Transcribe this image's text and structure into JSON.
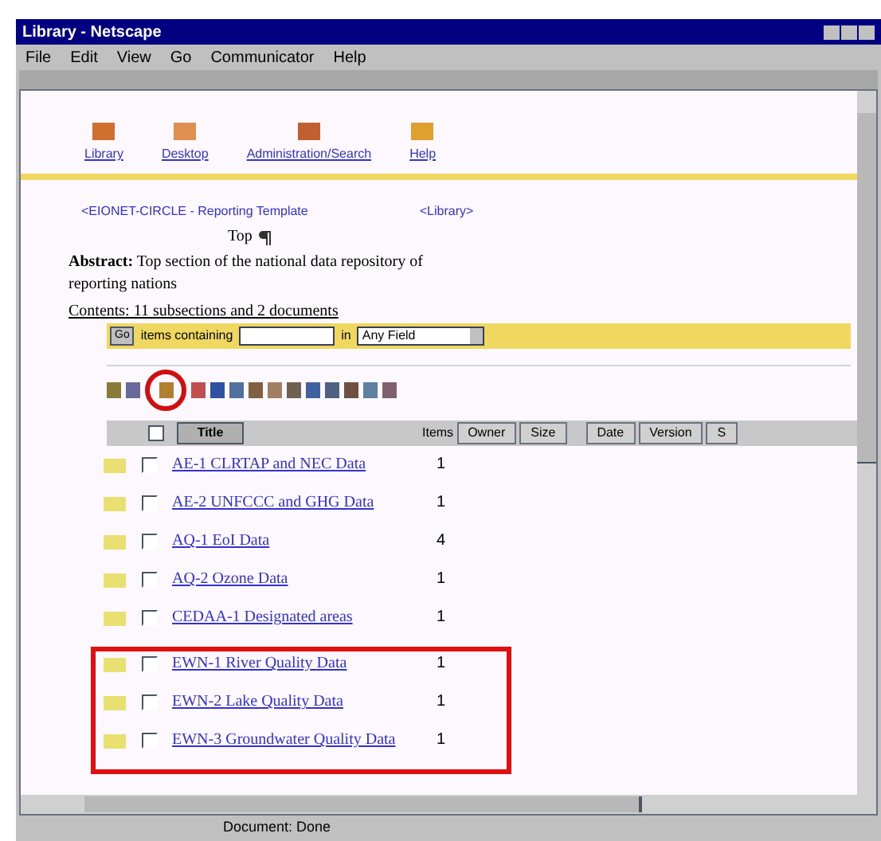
{
  "window": {
    "title": "Library - Netscape"
  },
  "menu": [
    "File",
    "Edit",
    "View",
    "Go",
    "Communicator",
    "Help"
  ],
  "nav": [
    {
      "label": "Library"
    },
    {
      "label": "Desktop"
    },
    {
      "label": "Administration/Search"
    },
    {
      "label": "Help"
    }
  ],
  "breadcrumb": {
    "path": "<EIONET-CIRCLE - Reporting Template",
    "link": "<Library>"
  },
  "heading": "Top",
  "abstract": {
    "label": "Abstract:",
    "text": "Top section of the national data repository of reporting nations"
  },
  "contents": "Contents: 11 subsections and 2 documents",
  "search": {
    "button": "Go",
    "label": "items containing",
    "in": "in",
    "field": "Any Field"
  },
  "toolbar": [
    {
      "circled": false
    },
    {
      "circled": false
    },
    {
      "circled": true
    },
    {
      "circled": false
    },
    {
      "circled": false
    },
    {
      "circled": false
    },
    {
      "circled": false
    },
    {
      "circled": false
    },
    {
      "circled": false
    },
    {
      "circled": false
    },
    {
      "circled": false
    },
    {
      "circled": false
    },
    {
      "circled": false
    },
    {
      "circled": false
    }
  ],
  "table": {
    "select_all_checked": false,
    "columns": [
      "Title",
      "Items",
      "Owner",
      "Size",
      "Date",
      "Version",
      "S"
    ],
    "row_groups": [
      {
        "framed": false,
        "rows": [
          {
            "title": "AE-1 CLRTAP and NEC Data",
            "items": "1",
            "checked": false
          },
          {
            "title": "AE-2 UNFCCC and GHG Data",
            "items": "1",
            "checked": false
          },
          {
            "title": "AQ-1 EoI Data",
            "items": "4",
            "checked": false
          },
          {
            "title": "AQ-2 Ozone Data",
            "items": "1",
            "checked": false
          },
          {
            "title": "CEDAA-1 Designated areas",
            "items": "1",
            "checked": false
          }
        ]
      },
      {
        "framed": true,
        "rows": [
          {
            "title": "EWN-1 River Quality Data",
            "items": "1",
            "checked": false
          },
          {
            "title": "EWN-2 Lake Quality Data",
            "items": "1",
            "checked": false
          },
          {
            "title": "EWN-3 Groundwater Quality Data",
            "items": "1",
            "checked": false
          }
        ]
      }
    ]
  },
  "status_bar": "Document: Done"
}
